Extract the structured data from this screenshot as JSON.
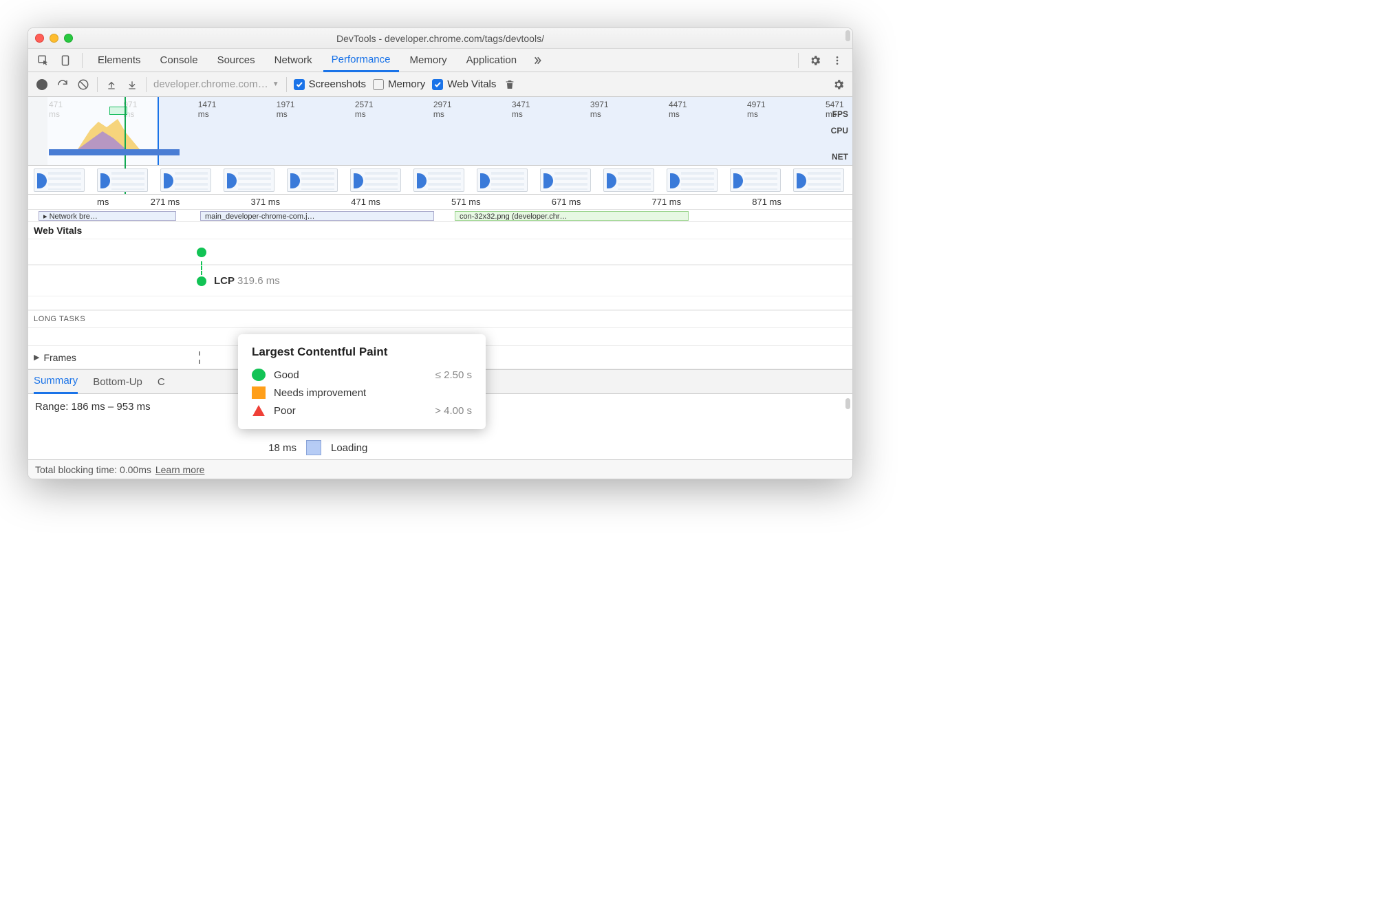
{
  "window": {
    "title": "DevTools - developer.chrome.com/tags/devtools/"
  },
  "tabs": {
    "items": [
      "Elements",
      "Console",
      "Sources",
      "Network",
      "Performance",
      "Memory",
      "Application"
    ],
    "active": "Performance"
  },
  "toolbar": {
    "url": "developer.chrome.com…",
    "screenshots": {
      "label": "Screenshots",
      "checked": true
    },
    "memory": {
      "label": "Memory",
      "checked": false
    },
    "webvitals": {
      "label": "Web Vitals",
      "checked": true
    }
  },
  "overview": {
    "ticks": [
      "471 ms",
      "971 ms",
      "1471 ms",
      "1971 ms",
      "2571 ms",
      "2971 ms",
      "3471 ms",
      "3971 ms",
      "4471 ms",
      "4971 ms",
      "5471 ms"
    ],
    "labels": {
      "fps": "FPS",
      "cpu": "CPU",
      "net": "NET"
    }
  },
  "flame": {
    "ticks": [
      "ms",
      "271 ms",
      "371 ms",
      "471 ms",
      "571 ms",
      "671 ms",
      "771 ms",
      "871 ms"
    ],
    "chips": {
      "a": "▸ Network bre…",
      "b": "main_developer-chrome-com.j…",
      "c": "con-32x32.png (developer.chr…"
    }
  },
  "vitals": {
    "header": "Web Vitals",
    "lcp": {
      "label": "LCP",
      "time": "319.6 ms"
    },
    "longtasks": "LONG TASKS",
    "frames": "Frames"
  },
  "tooltip": {
    "title": "Largest Contentful Paint",
    "rows": [
      {
        "label": "Good",
        "value": "≤ 2.50 s"
      },
      {
        "label": "Needs improvement",
        "value": ""
      },
      {
        "label": "Poor",
        "value": "> 4.00 s"
      }
    ]
  },
  "bottom_tabs": [
    "Summary",
    "Bottom-Up",
    "C"
  ],
  "summary": {
    "range": "Range: 186 ms – 953 ms",
    "loading": {
      "time": "18 ms",
      "label": "Loading"
    }
  },
  "footer": {
    "text": "Total blocking time: 0.00ms",
    "link": "Learn more"
  }
}
